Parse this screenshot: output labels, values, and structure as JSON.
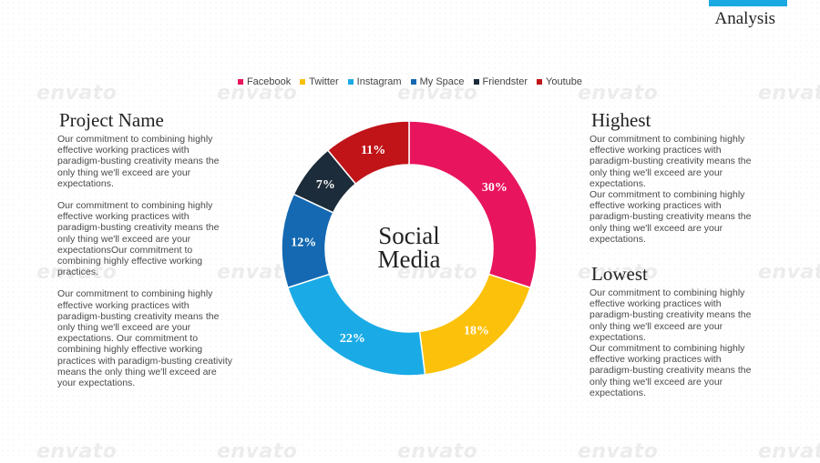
{
  "header": {
    "title": "Analysis",
    "accent_color": "#1ba9e1"
  },
  "watermark": {
    "text": "envato"
  },
  "chart_data": {
    "type": "pie",
    "donut": true,
    "center_label": [
      "Social",
      "Media"
    ],
    "legend_position": "top",
    "categories": [
      "Facebook",
      "Twitter",
      "Instagram",
      "My Space",
      "Friendster",
      "Youtube"
    ],
    "values": [
      30,
      18,
      22,
      12,
      7,
      11
    ],
    "labels": [
      "30%",
      "18%",
      "22%",
      "12%",
      "7%",
      "11%"
    ],
    "colors": [
      "#e8145e",
      "#fcc10a",
      "#1aabe6",
      "#1469b2",
      "#1d2c3a",
      "#c01419"
    ]
  },
  "left": {
    "title": "Project Name",
    "paragraphs": [
      "Our commitment to combining highly effective working practices with paradigm-busting creativity means the only thing we'll exceed are your expectations.",
      "Our commitment to combining highly effective working practices with paradigm-busting creativity means the only thing we'll exceed are your expectationsOur commitment to combining highly effective working practices.",
      "Our commitment to combining highly effective working practices with paradigm-busting creativity means the only thing we'll exceed are your expectations. Our commitment to combining highly effective working practices with paradigm-busting creativity means the only thing we'll exceed are your expectations."
    ]
  },
  "highest": {
    "title": "Highest",
    "paragraphs": [
      "Our commitment to combining highly effective working practices with paradigm-busting creativity means the only thing we'll exceed are your expectations.",
      "Our commitment to combining highly effective working practices with paradigm-busting creativity means the only thing we'll exceed are your expectations."
    ]
  },
  "lowest": {
    "title": "Lowest",
    "paragraphs": [
      "Our commitment to combining highly effective working practices with paradigm-busting creativity means the only thing we'll exceed are your expectations.",
      "Our commitment to combining highly effective working practices with paradigm-busting creativity means the only thing we'll exceed are your expectations."
    ]
  }
}
